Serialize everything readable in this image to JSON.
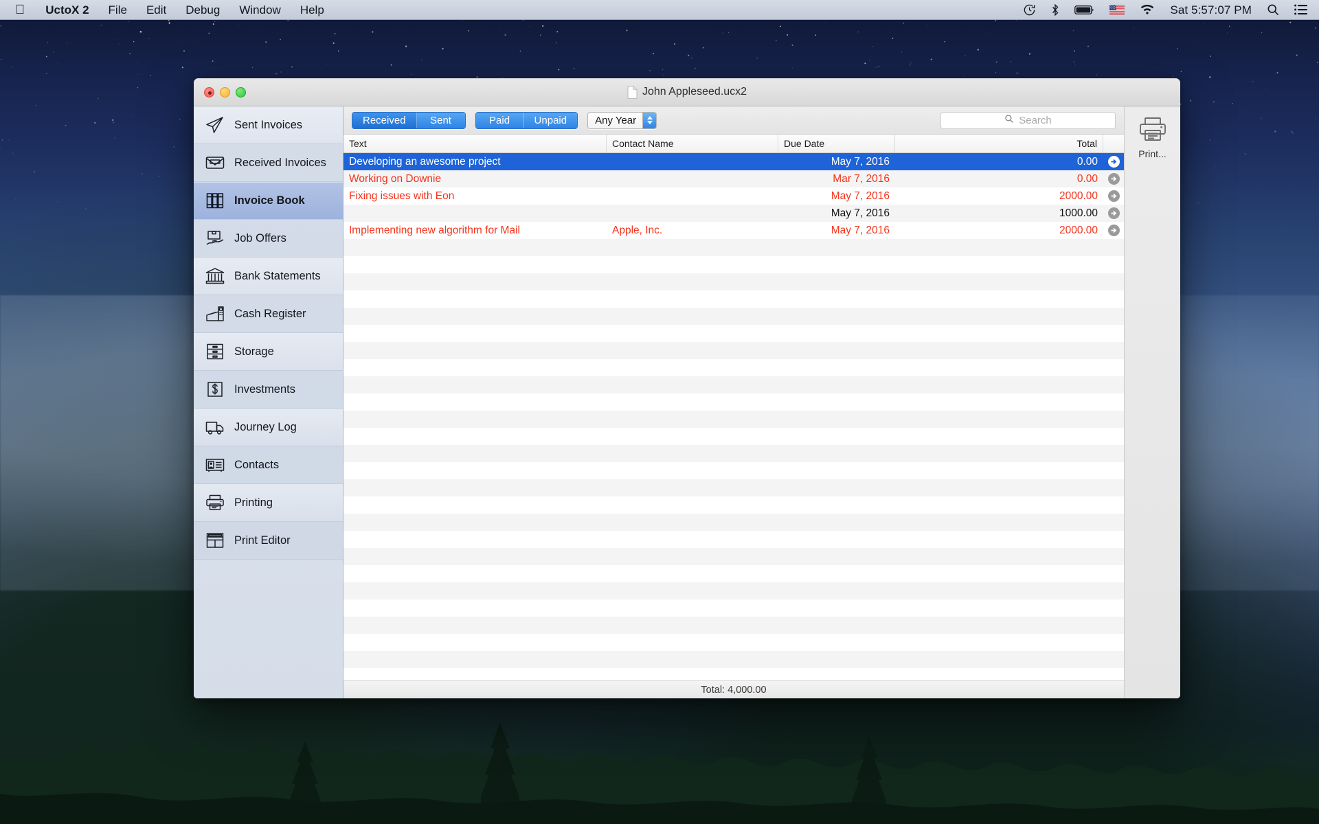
{
  "menubar": {
    "apple_icon": "apple-logo-icon",
    "items": [
      {
        "label": "UctoX 2",
        "bold": true
      },
      {
        "label": "File"
      },
      {
        "label": "Edit"
      },
      {
        "label": "Debug"
      },
      {
        "label": "Window"
      },
      {
        "label": "Help"
      }
    ],
    "status_icons": [
      "time-machine-icon",
      "bluetooth-icon",
      "battery-icon",
      "us-flag-input-icon",
      "wifi-icon"
    ],
    "clock": "Sat 5:57:07 PM",
    "spotlight_icon": "search-icon",
    "notification_center_icon": "list-icon"
  },
  "window": {
    "title": "John Appleseed.ucx2",
    "document_icon": "document-icon",
    "traffic_lights": [
      "close-button",
      "minimize-button",
      "zoom-button"
    ]
  },
  "sidebar": {
    "items": [
      {
        "label": "Sent Invoices",
        "icon": "paper-plane-icon",
        "selected": false
      },
      {
        "label": "Received Invoices",
        "icon": "envelope-icon",
        "selected": false
      },
      {
        "label": "Invoice Book",
        "icon": "binders-icon",
        "selected": true
      },
      {
        "label": "Job Offers",
        "icon": "box-hand-icon",
        "selected": false
      },
      {
        "label": "Bank Statements",
        "icon": "bank-icon",
        "selected": false
      },
      {
        "label": "Cash Register",
        "icon": "cash-register-icon",
        "selected": false
      },
      {
        "label": "Storage",
        "icon": "drawers-icon",
        "selected": false
      },
      {
        "label": "Investments",
        "icon": "dollar-icon",
        "selected": false
      },
      {
        "label": "Journey Log",
        "icon": "truck-icon",
        "selected": false
      },
      {
        "label": "Contacts",
        "icon": "contact-card-icon",
        "selected": false
      },
      {
        "label": "Printing",
        "icon": "printer-icon",
        "selected": false
      },
      {
        "label": "Print Editor",
        "icon": "print-editor-icon",
        "selected": false
      }
    ]
  },
  "toolbar": {
    "direction_segments": [
      {
        "label": "Received",
        "selected": true
      },
      {
        "label": "Sent",
        "selected": false
      }
    ],
    "payment_segments": [
      {
        "label": "Paid",
        "selected": false
      },
      {
        "label": "Unpaid",
        "selected": false
      }
    ],
    "year_popup": {
      "value": "Any Year",
      "icon": "stepper-arrows-icon"
    },
    "search": {
      "placeholder": "Search",
      "value": "",
      "icon": "search-icon"
    }
  },
  "right_pane": {
    "print_button": {
      "label": "Print...",
      "icon": "printer-icon"
    }
  },
  "table": {
    "columns": [
      "Text",
      "Contact Name",
      "Due Date",
      "Total"
    ],
    "rows": [
      {
        "text": "Developing an awesome project",
        "contact": "",
        "due": "May 7, 2016",
        "total": "0.00",
        "state": "selected",
        "arrow_icon": "disclosure-arrow-icon"
      },
      {
        "text": "Working on Downie",
        "contact": "",
        "due": "Mar 7, 2016",
        "total": "0.00",
        "state": "overdue",
        "arrow_icon": "disclosure-arrow-icon"
      },
      {
        "text": "Fixing issues with Eon",
        "contact": "",
        "due": "May 7, 2016",
        "total": "2000.00",
        "state": "overdue",
        "arrow_icon": "disclosure-arrow-icon"
      },
      {
        "text": "",
        "contact": "",
        "due": "May 7, 2016",
        "total": "1000.00",
        "state": "normal",
        "arrow_icon": "disclosure-arrow-icon"
      },
      {
        "text": "Implementing new algorithm for Mail",
        "contact": "Apple, Inc.",
        "due": "May 7, 2016",
        "total": "2000.00",
        "state": "overdue",
        "arrow_icon": "disclosure-arrow-icon"
      }
    ],
    "empty_row_count": 27
  },
  "status_bar": {
    "total": "Total: 4,000.00"
  },
  "colors": {
    "selection_blue": "#1e63d8",
    "overdue_red": "#f5331a",
    "segment_blue": "#2f84e6",
    "sidebar_selected": "#9db2dd"
  }
}
